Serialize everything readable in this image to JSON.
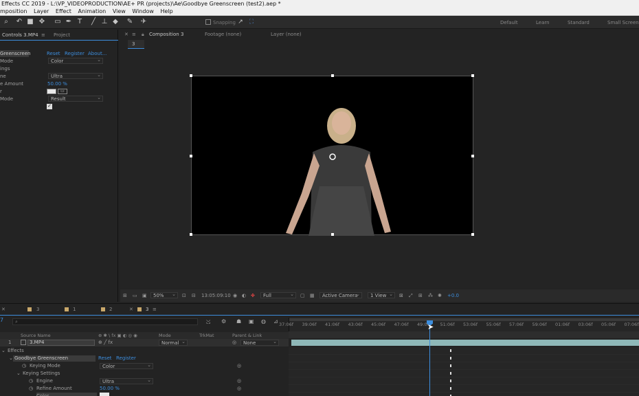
{
  "window": {
    "title": "Effects CC 2019 - L:\\VP_VIDEOPRODUCTION\\AE+ PR (projects)\\Ae\\Goodbye Greenscreen (test2).aep *"
  },
  "menu": [
    "mposition",
    "Layer",
    "Effect",
    "Animation",
    "View",
    "Window",
    "Help"
  ],
  "toolbar": {
    "snapping_label": "Snapping",
    "workspaces": [
      "Default",
      "Learn",
      "Standard",
      "Small Screen"
    ]
  },
  "left_panel": {
    "tab_controls": "Controls 3.MP4",
    "tab_project": "Project",
    "effect_name": "Greenscreen",
    "reset": "Reset",
    "register": "Register",
    "about": "About...",
    "rows": [
      {
        "label": "Mode",
        "value": "Color"
      },
      {
        "label": "ings",
        "value": ""
      },
      {
        "label": "ne",
        "value": "Ultra"
      },
      {
        "label": "e Amount",
        "value": "50.00 %"
      },
      {
        "label": "r",
        "value": ""
      },
      {
        "label": "Mode",
        "value": "Result"
      }
    ]
  },
  "viewer": {
    "tab_composition": "Composition 3",
    "tab_footage": "Footage (none)",
    "tab_layer": "Layer (none)",
    "comp_subtab": "3",
    "zoom": "50%",
    "timecode": "13:05:09:10",
    "resolution": "Full",
    "camera": "Active Camera",
    "view": "1 View",
    "exposure": "+0.0"
  },
  "timeline": {
    "comp_tabs": [
      "3",
      "1",
      "2",
      "3"
    ],
    "current_time_short": "7",
    "columns": {
      "source_name": "Source Name",
      "mode": "Mode",
      "trkmat": "TrkMat",
      "parent": "Parent & Link"
    },
    "layer": {
      "index": "1",
      "name": "3.MP4",
      "mode": "Normal",
      "parent": "None"
    },
    "effects_label": "Effects",
    "effect_name": "Goodbye Greenscreen",
    "effect_reset": "Reset",
    "effect_register": "Register",
    "props": [
      {
        "label": "Keying Mode",
        "value": "Color"
      },
      {
        "label": "Keying Settings",
        "value": ""
      },
      {
        "label": "Engine",
        "value": "Ultra"
      },
      {
        "label": "Refine Amount",
        "value": "50.00 %"
      },
      {
        "label": "Color",
        "value": ""
      }
    ],
    "ticks": [
      "37:06f",
      "39:06f",
      "41:06f",
      "43:06f",
      "45:06f",
      "47:06f",
      "49:06f",
      "51:06f",
      "53:06f",
      "55:06f",
      "57:06f",
      "59:06f",
      "01:06f",
      "03:06f",
      "05:06f",
      "07:06f"
    ]
  },
  "colors": {
    "accent": "#3d8ede",
    "layer_bar": "#8fb8b8"
  }
}
